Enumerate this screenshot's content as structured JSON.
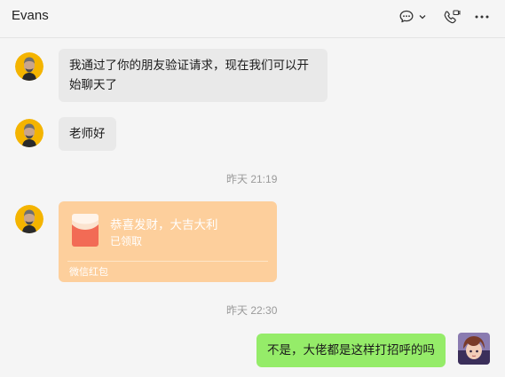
{
  "window": {
    "title": "Evans"
  },
  "header": {
    "icons": [
      "chat-bubble-icon",
      "chevron-down-icon",
      "video-call-icon",
      "more-icon"
    ]
  },
  "messages": [
    {
      "text": "我通过了你的朋友验证请求，现在我们可以开始聊天了",
      "line1": "我通过了你的朋友验证请求，现在我们可以开",
      "line2": "始聊天了"
    },
    {
      "text": "老师好"
    },
    {
      "text": "不是，大佬都是这样打招呼的吗"
    }
  ],
  "timestamps": [
    "昨天 21:19",
    "昨天 22:30"
  ],
  "red_packet": {
    "title": "恭喜发财，大吉大利",
    "status": "已领取",
    "footer": "微信红包"
  },
  "colors": {
    "background": "#f5f5f5",
    "incoming_bubble": "#e9e9e9",
    "outgoing_bubble": "#95ec69",
    "red_packet": "#fdcf9c"
  }
}
